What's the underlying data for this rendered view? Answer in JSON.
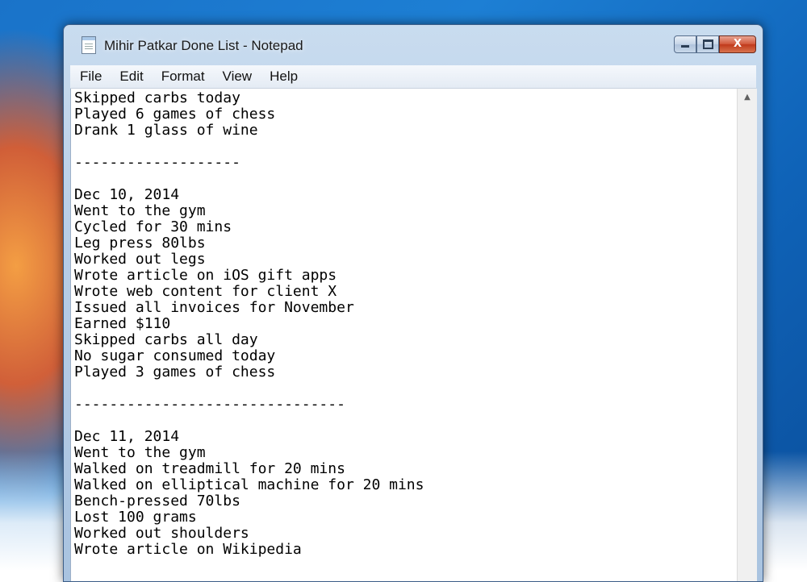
{
  "window": {
    "title": "Mihir Patkar Done List - Notepad",
    "controls": {
      "minimize": "minimize",
      "maximize": "maximize",
      "close": "X"
    }
  },
  "menu": {
    "file": "File",
    "edit": "Edit",
    "format": "Format",
    "view": "View",
    "help": "Help"
  },
  "editor": {
    "text": "Skipped carbs today\nPlayed 6 games of chess\nDrank 1 glass of wine\n\n-------------------\n\nDec 10, 2014\nWent to the gym\nCycled for 30 mins\nLeg press 80lbs\nWorked out legs\nWrote article on iOS gift apps\nWrote web content for client X\nIssued all invoices for November\nEarned $110\nSkipped carbs all day\nNo sugar consumed today\nPlayed 3 games of chess\n\n-------------------------------\n\nDec 11, 2014\nWent to the gym\nWalked on treadmill for 20 mins\nWalked on elliptical machine for 20 mins\nBench-pressed 70lbs\nLost 100 grams\nWorked out shoulders\nWrote article on Wikipedia"
  },
  "scrollbar": {
    "up_arrow": "▲"
  }
}
